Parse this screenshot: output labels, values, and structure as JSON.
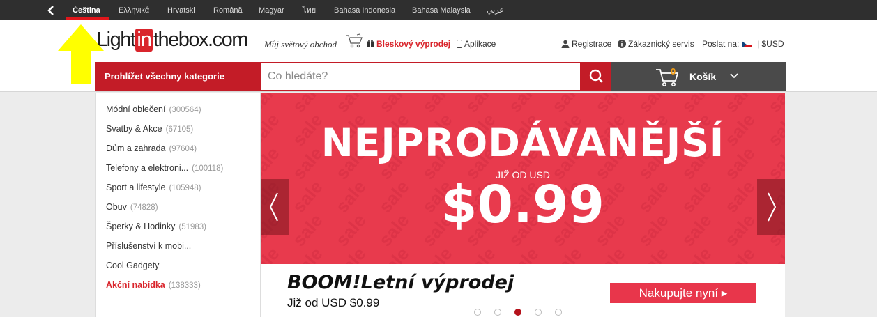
{
  "languages": {
    "items": [
      {
        "label": "Čeština",
        "active": true
      },
      {
        "label": "Ελληνικά"
      },
      {
        "label": "Hrvatski"
      },
      {
        "label": "Română"
      },
      {
        "label": "Magyar"
      },
      {
        "label": "ไทย"
      },
      {
        "label": "Bahasa Indonesia"
      },
      {
        "label": "Bahasa Malaysia"
      },
      {
        "label": "عربي"
      }
    ]
  },
  "header": {
    "logo_light": "Light",
    "logo_in": "in",
    "logo_rest": "thebox.com",
    "tagline": "Můj světový obchod",
    "flash_sale": "Bleskový výprodej",
    "app": "Aplikace",
    "register": "Registrace",
    "support": "Zákaznický servis",
    "ship_to": "Poslat na:",
    "currency": "$USD"
  },
  "navbar": {
    "categories_button": "Prohlížet všechny kategorie",
    "search_placeholder": "Co hledáte?",
    "cart_count": "0",
    "cart_label": "Košík"
  },
  "sidebar": {
    "items": [
      {
        "label": "Módní oblečení",
        "count": "(300564)"
      },
      {
        "label": "Svatby & Akce",
        "count": "(67105)"
      },
      {
        "label": "Dům a zahrada",
        "count": "(97604)"
      },
      {
        "label": "Telefony a elektroni...",
        "count": "(100118)"
      },
      {
        "label": "Sport a lifestyle",
        "count": "(105948)"
      },
      {
        "label": "Obuv",
        "count": "(74828)"
      },
      {
        "label": "Šperky & Hodinky",
        "count": "(51983)"
      },
      {
        "label": "Příslušenství k mobi...",
        "count": ""
      },
      {
        "label": "Cool Gadgety",
        "count": ""
      },
      {
        "label": "Akční nabídka",
        "count": "(138333)",
        "hot": true
      }
    ]
  },
  "banner": {
    "headline": "NEJPRODÁVANĚJŠÍ",
    "from_text": "JIŽ OD USD",
    "price": "$0.99",
    "watermark": "sale"
  },
  "promo": {
    "title": "BOOM!Letní výprodej",
    "from": "Již od USD $0.99",
    "shop_button": "Nakupujte nyní ▸",
    "active_slide": 3,
    "slide_count": 5
  },
  "colors": {
    "brand_red": "#c31c27",
    "banner_red": "#e83a4d",
    "topbar": "#2f2f2f",
    "annotation_yellow": "#ffff00"
  }
}
